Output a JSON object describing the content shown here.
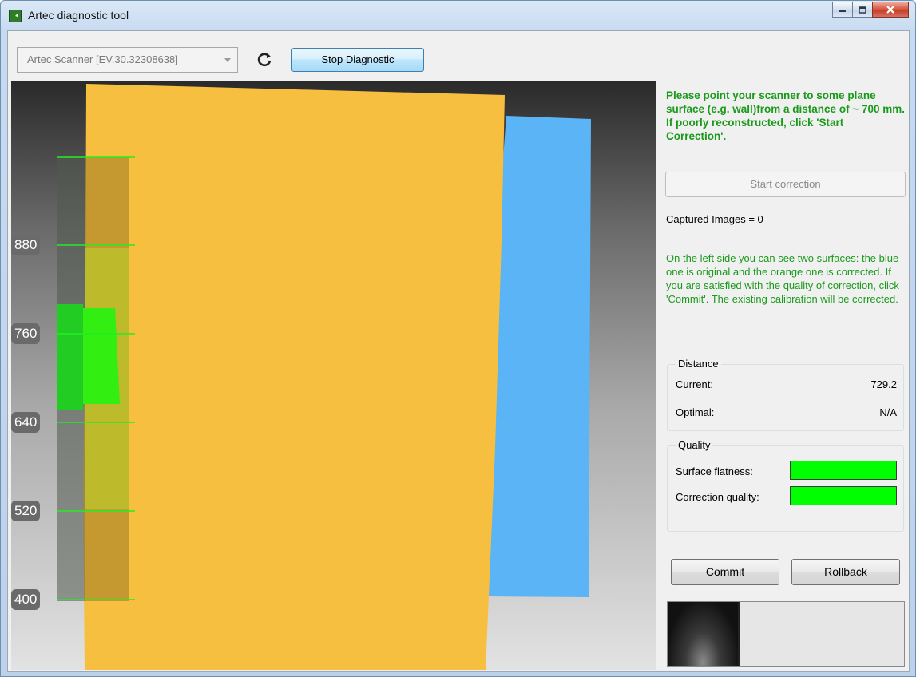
{
  "window": {
    "title": "Artec diagnostic tool"
  },
  "toolbar": {
    "device_select": "Artec Scanner [EV.30.32308638]",
    "stop_label": "Stop Diagnostic",
    "refresh_icon": "refresh-icon"
  },
  "viewport": {
    "scale_ticks": [
      "880",
      "760",
      "640",
      "520",
      "400"
    ],
    "colors": {
      "original_surface": "#5ab4f5",
      "corrected_surface": "#f7bf3f",
      "range_indicator": "#22dd22"
    }
  },
  "panel": {
    "instruction": "Please point your scanner to some plane surface (e.g. wall)from a distance of ~ 700 mm. If poorly reconstructed, click 'Start Correction'.",
    "start_correction_label": "Start correction",
    "captured_images": "Captured Images = 0",
    "info": "On the left side you can see two surfaces: the blue one is original and the orange one is corrected. If you are satisfied with the quality of correction, click 'Commit'. The existing calibration will be corrected.",
    "distance": {
      "title": "Distance",
      "current_label": "Current:",
      "current_value": "729.2",
      "optimal_label": "Optimal:",
      "optimal_value": "N/A"
    },
    "quality": {
      "title": "Quality",
      "flatness_label": "Surface flatness:",
      "correction_label": "Correction quality:",
      "flatness_level": 1.0,
      "correction_level": 1.0,
      "bar_color": "#00ff00"
    },
    "commit_label": "Commit",
    "rollback_label": "Rollback"
  }
}
